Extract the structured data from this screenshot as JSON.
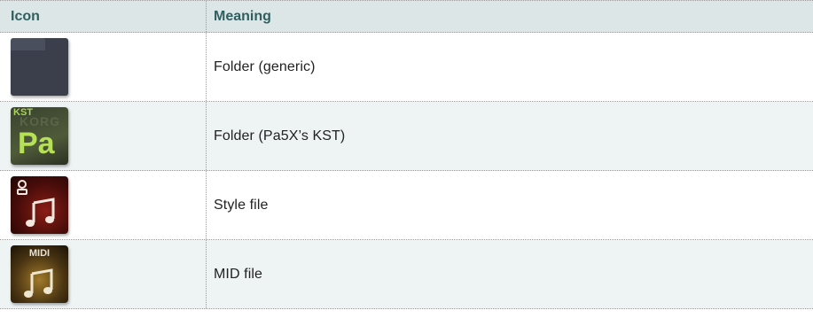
{
  "table": {
    "headers": {
      "icon": "Icon",
      "meaning": "Meaning"
    },
    "rows": [
      {
        "icon": "folder-generic-icon",
        "meaning": "Folder (generic)"
      },
      {
        "icon": "folder-kst-icon",
        "meaning": "Folder (Pa5X’s KST)",
        "icon_top_text": "KST",
        "icon_main_text": "Pa"
      },
      {
        "icon": "style-file-icon",
        "meaning": "Style file"
      },
      {
        "icon": "mid-file-icon",
        "meaning": "MID file",
        "icon_top_text": "MIDI"
      }
    ]
  },
  "colors": {
    "header_bg": "#dde6e6",
    "header_text": "#2f5f5f",
    "shaded_row_bg": "#eef3f3"
  }
}
